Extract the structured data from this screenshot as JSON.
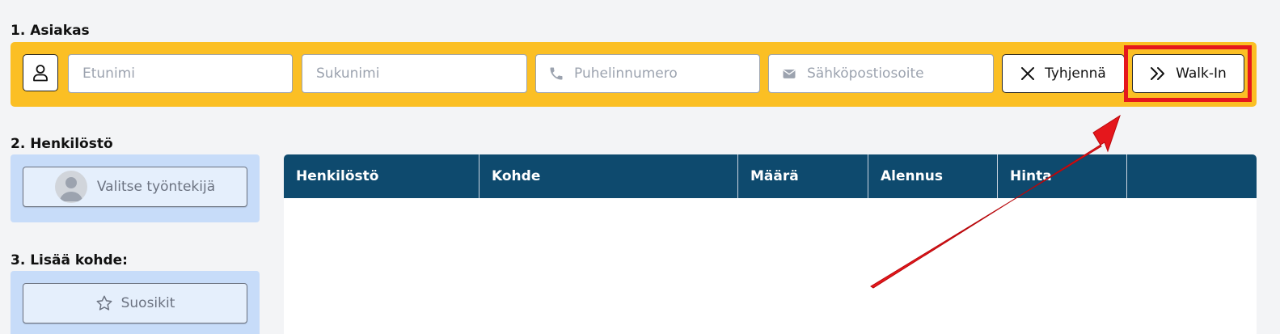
{
  "sections": {
    "customer_title": "1. Asiakas",
    "staff_title": "2. Henkilöstö",
    "add_item_title": "3. Lisää kohde:"
  },
  "customer": {
    "first_name": {
      "value": "",
      "placeholder": "Etunimi"
    },
    "last_name": {
      "value": "",
      "placeholder": "Sukunimi"
    },
    "phone": {
      "value": "",
      "placeholder": "Puhelinnumero"
    },
    "email": {
      "value": "",
      "placeholder": "Sähköpostiosoite"
    },
    "clear_label": "Tyhjennä",
    "walkin_label": "Walk-In"
  },
  "staff": {
    "select_label": "Valitse työntekijä"
  },
  "add_item": {
    "favorites_label": "Suosikit"
  },
  "table": {
    "headers": [
      "Henkilöstö",
      "Kohde",
      "Määrä",
      "Alennus",
      "Hinta",
      ""
    ]
  },
  "colors": {
    "customer_bar": "#fbbf24",
    "panel_blue": "#c7dcf9",
    "table_header": "#0e4a6e",
    "highlight_red": "#e5171c"
  },
  "icons": {
    "user": "user-icon",
    "phone": "phone-icon",
    "email": "envelope-icon",
    "clear": "close-icon",
    "walkin": "double-chevron-right-icon",
    "favorites": "star-icon"
  }
}
